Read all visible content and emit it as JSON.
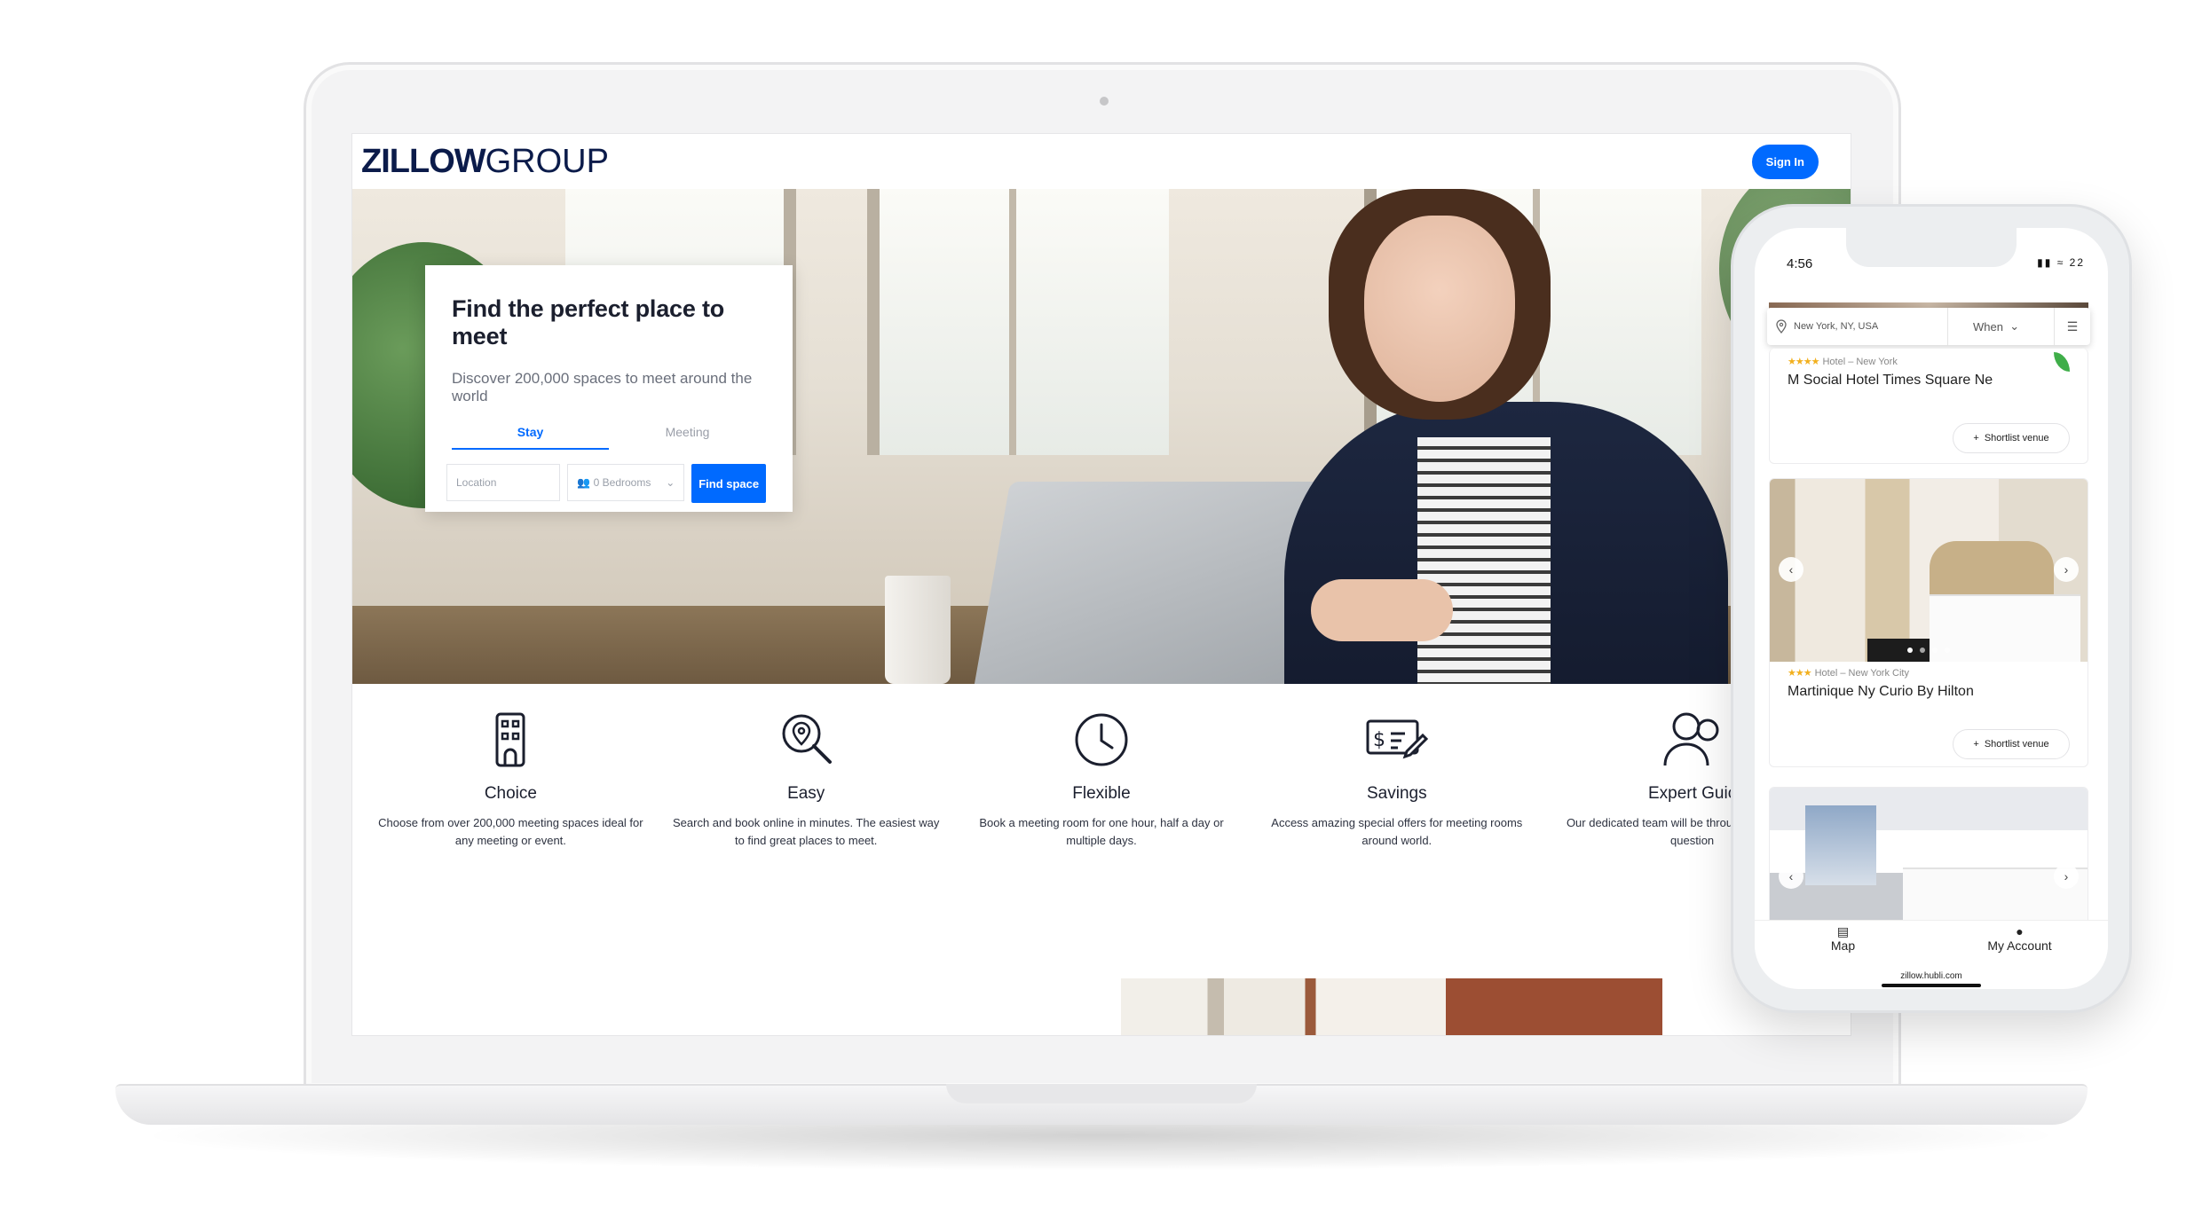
{
  "website": {
    "logo_bold": "ZILLOW",
    "logo_light": "GROUP",
    "sign_in": "Sign In",
    "search": {
      "title": "Find the perfect place to meet",
      "subtitle": "Discover 200,000 spaces to meet around the world",
      "tabs": [
        "Stay",
        "Meeting"
      ],
      "active_tab": "Stay",
      "location_placeholder": "Location",
      "bedrooms_value": "0 Bedrooms",
      "find_button": "Find space"
    },
    "features": [
      {
        "icon": "building-icon",
        "title": "Choice",
        "desc": "Choose from over 200,000 meeting spaces ideal for any meeting or event."
      },
      {
        "icon": "location-search-icon",
        "title": "Easy",
        "desc": "Search and book online in minutes. The easiest way to find great places to meet."
      },
      {
        "icon": "clock-icon",
        "title": "Flexible",
        "desc": "Book a meeting room for one hour, half a day or multiple days."
      },
      {
        "icon": "check-pen-icon",
        "title": "Savings",
        "desc": "Access amazing special offers for meeting rooms around world."
      },
      {
        "icon": "people-icon",
        "title": "Expert Guic",
        "desc": "Our dedicated team will be through the process a question"
      }
    ]
  },
  "phone": {
    "time": "4:56",
    "battery": "22",
    "search_location": "New York, NY, USA",
    "when_label": "When",
    "cards": [
      {
        "stars": "★★★★",
        "meta": "Hotel – New York",
        "name": "M Social Hotel Times Square Ne",
        "button": "Shortlist venue"
      },
      {
        "stars": "★★★",
        "meta": "Hotel – New York City",
        "name": "Martinique Ny Curio By Hilton",
        "button": "Shortlist venue"
      }
    ],
    "tabbar": [
      {
        "icon": "map-icon",
        "label": "Map"
      },
      {
        "icon": "person-icon",
        "label": "My Account"
      }
    ],
    "url": "zillow.hubli.com"
  },
  "colors": {
    "accent": "#006aff",
    "logo": "#0b1b4a",
    "star": "#f2b01e"
  }
}
